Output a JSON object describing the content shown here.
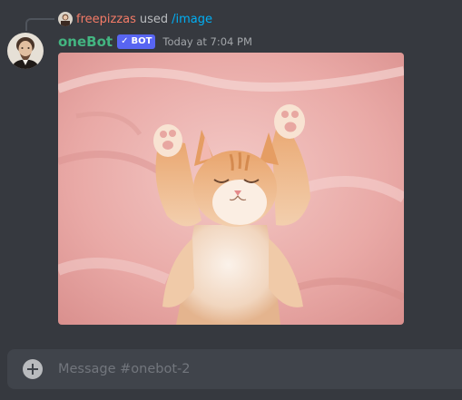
{
  "command_usage": {
    "user": "freepizzas",
    "used_text": "used",
    "command": "/image",
    "user_color": "#f47b67",
    "command_color": "#00aff4"
  },
  "message": {
    "author": "oneBot",
    "author_color": "#43b581",
    "bot_tag": "BOT",
    "bot_tag_icon": "check-icon",
    "bot_tag_color": "#5865f2",
    "timestamp": "Today at 7:04 PM",
    "image": {
      "subject": "sleeping orange kitten on pink blanket"
    }
  },
  "composer": {
    "placeholder": "Message #onebot-2",
    "add_icon": "plus-circle-icon"
  },
  "theme": {
    "background": "#36393f",
    "input_background": "#40444b"
  }
}
